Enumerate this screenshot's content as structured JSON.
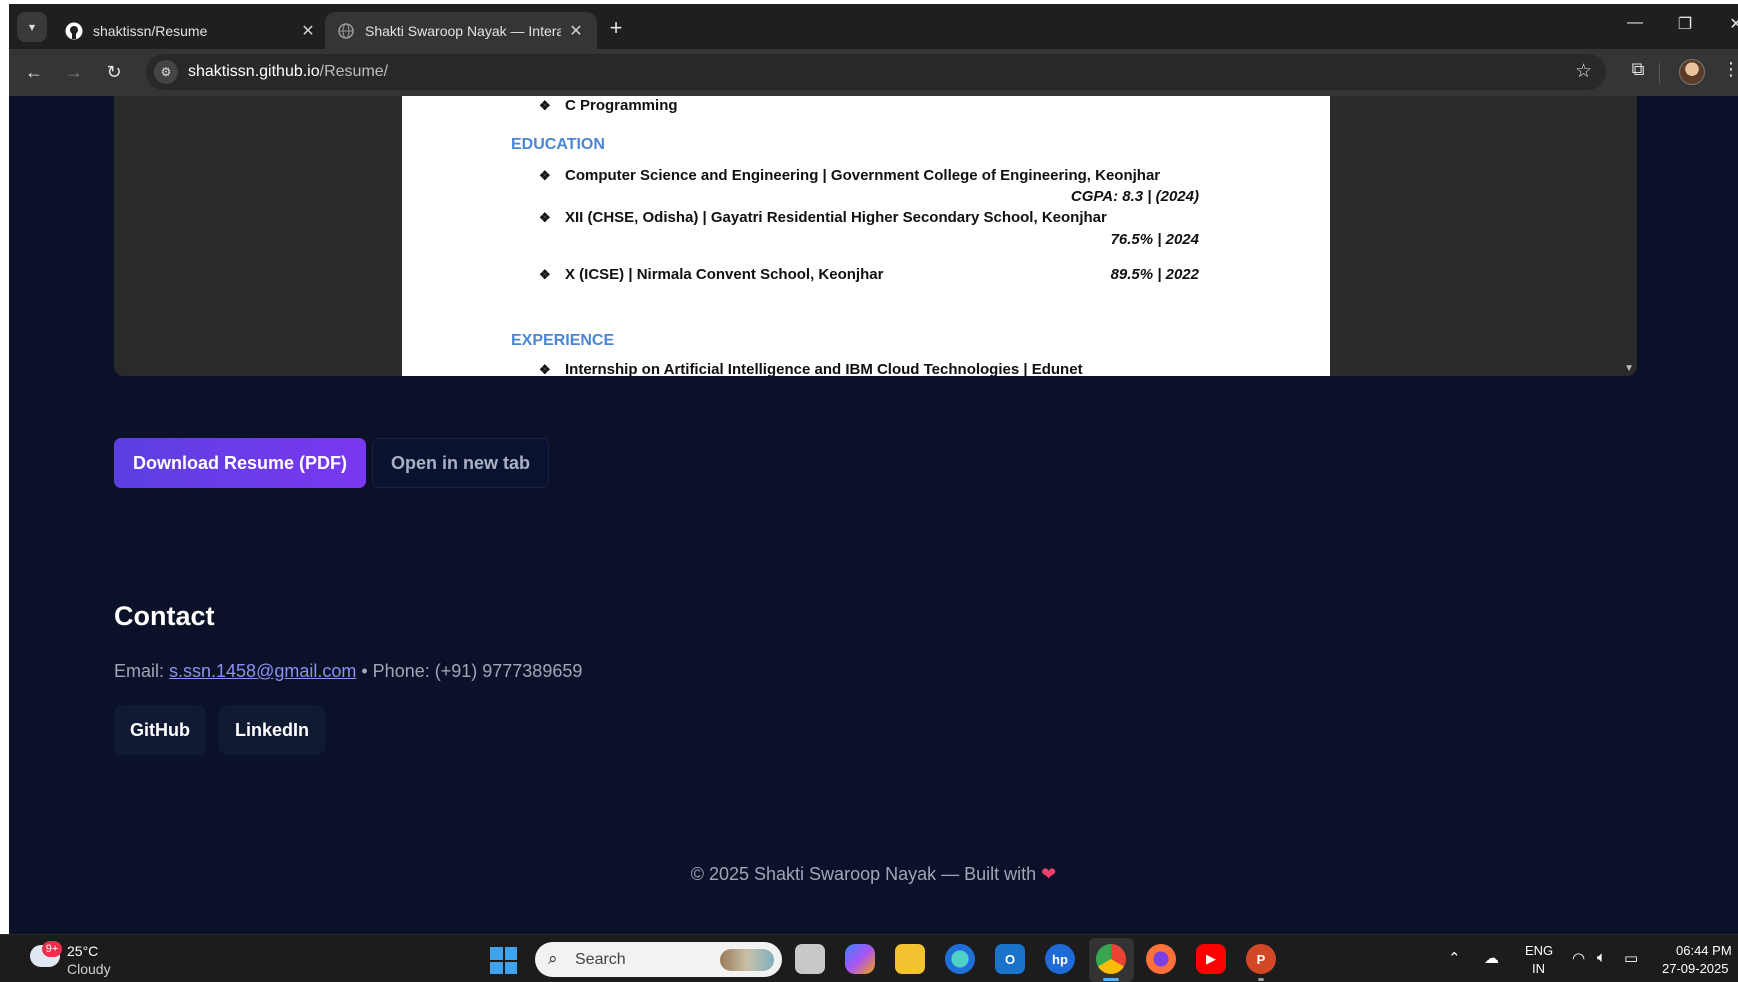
{
  "browser": {
    "tabs": [
      {
        "title": "shaktissn/Resume",
        "active": false
      },
      {
        "title": "Shakti Swaroop Nayak — Intera",
        "active": true
      }
    ],
    "url_host": "shaktissn.github.io",
    "url_path": "/Resume/"
  },
  "resume_pdf": {
    "skills_tail": "C Programming",
    "education_heading": "EDUCATION",
    "education": [
      {
        "line": "Computer Science and Engineering | Government College of Engineering, Keonjhar",
        "detail": "CGPA:  8.3 | (2024)"
      },
      {
        "line": "XII (CHSE, Odisha) | Gayatri Residential Higher Secondary School, Keonjhar",
        "detail": "76.5% | 2024"
      },
      {
        "line": "X (ICSE) | Nirmala Convent School, Keonjhar",
        "detail": "89.5% | 2022"
      }
    ],
    "experience_heading": "EXPERIENCE",
    "experience": [
      {
        "line": "Internship on Artificial Intelligence and IBM Cloud Technologies | Edunet"
      }
    ]
  },
  "actions": {
    "download_label": "Download Resume (PDF)",
    "open_tab_label": "Open in new tab"
  },
  "contact": {
    "title": "Contact",
    "email_label": "Email: ",
    "email": "s.ssn.1458@gmail.com",
    "phone_text": " • Phone: (+91) 9777389659",
    "links": [
      "GitHub",
      "LinkedIn"
    ]
  },
  "footer": {
    "text": "© 2025 Shakti Swaroop Nayak — Built with",
    "heart": "❤"
  },
  "taskbar": {
    "weather_badge": "9+",
    "temperature": "25°C",
    "condition": "Cloudy",
    "search_placeholder": "Search",
    "language": "ENG",
    "region": "IN",
    "time": "06:44 PM",
    "date": "27-09-2025"
  },
  "colors": {
    "page_bg": "#0a1128",
    "accent": "#6a3cf0",
    "pdf_heading": "#4b86d6"
  }
}
